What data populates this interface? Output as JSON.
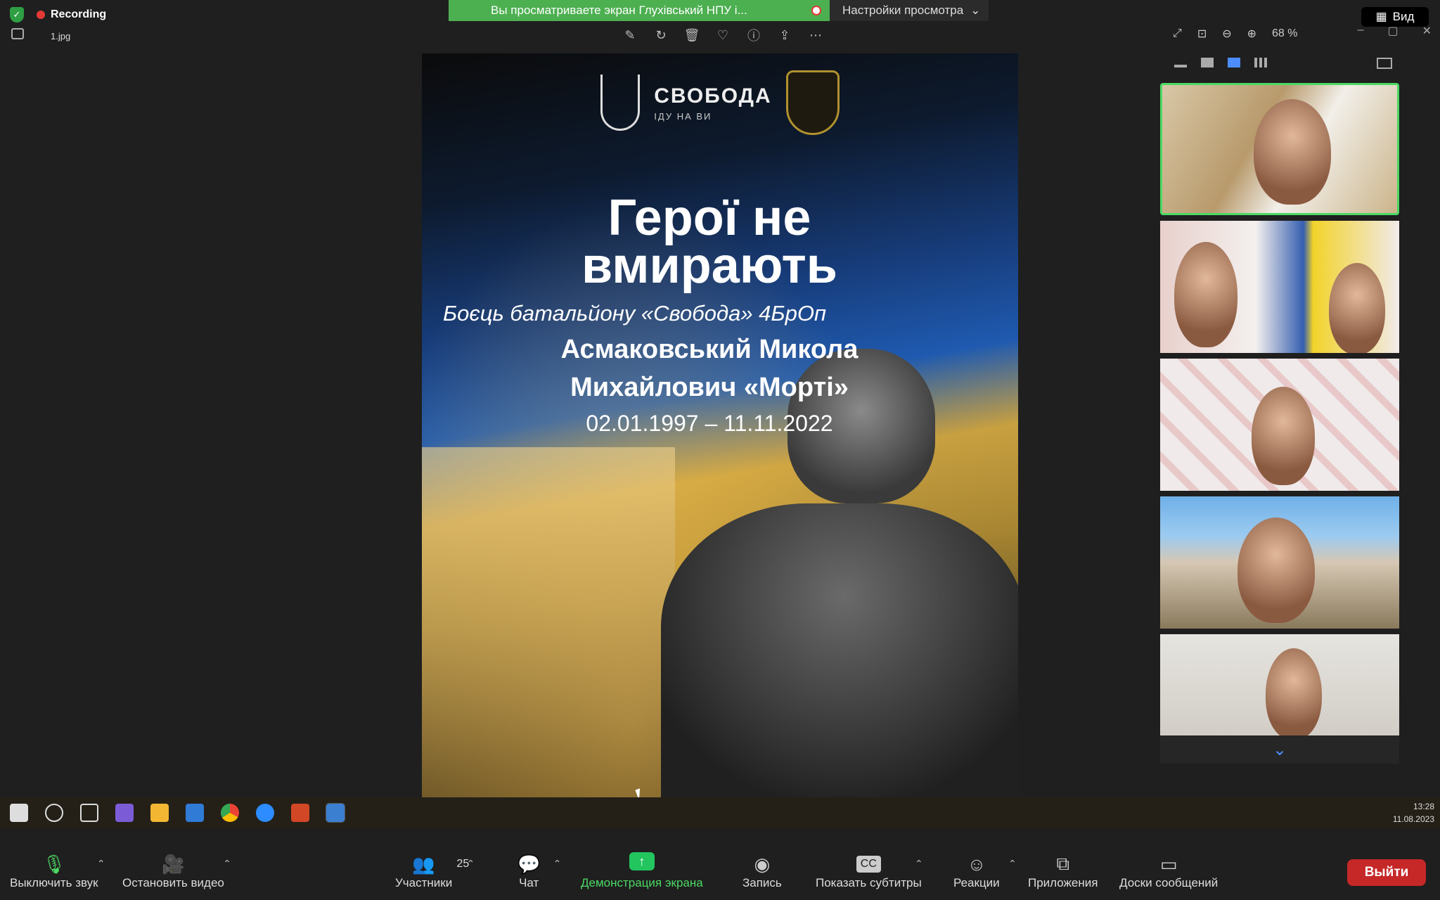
{
  "top_bar": {
    "recording_label": "Recording",
    "filename": "1.jpg",
    "share_banner_text": "Вы просматриваете экран Глухівський НПУ і...",
    "view_settings_label": "Настройки просмотра",
    "view_button_label": "Вид",
    "zoom_level": "68 %"
  },
  "slide": {
    "logo_title": "СВОБОДА",
    "logo_subtitle": "ІДУ НА ВИ",
    "heading_line1": "Герої не",
    "heading_line2": "вмирають",
    "subtitle": "Боєць батальйону «Свобода» 4БрОп",
    "name_line1": "Асмаковський Микола",
    "name_line2": "Михайлович «Морті»",
    "dates": "02.01.1997 – 11.11.2022"
  },
  "taskbar": {
    "time": "13:28",
    "date": "11.08.2023"
  },
  "controls": {
    "mute_label": "Выключить звук",
    "video_label": "Остановить видео",
    "participants_label": "Участники",
    "participants_count": "25",
    "chat_label": "Чат",
    "share_label": "Демонстрация экрана",
    "record_label": "Запись",
    "captions_label": "Показать субтитры",
    "captions_icon_text": "CC",
    "reactions_label": "Реакции",
    "apps_label": "Приложения",
    "whiteboards_label": "Доски сообщений",
    "leave_label": "Выйти"
  },
  "colors": {
    "share_green": "#4caf50",
    "active_tile": "#4cd964",
    "leave_red": "#c62828",
    "gallery_active": "#4c8dff"
  }
}
